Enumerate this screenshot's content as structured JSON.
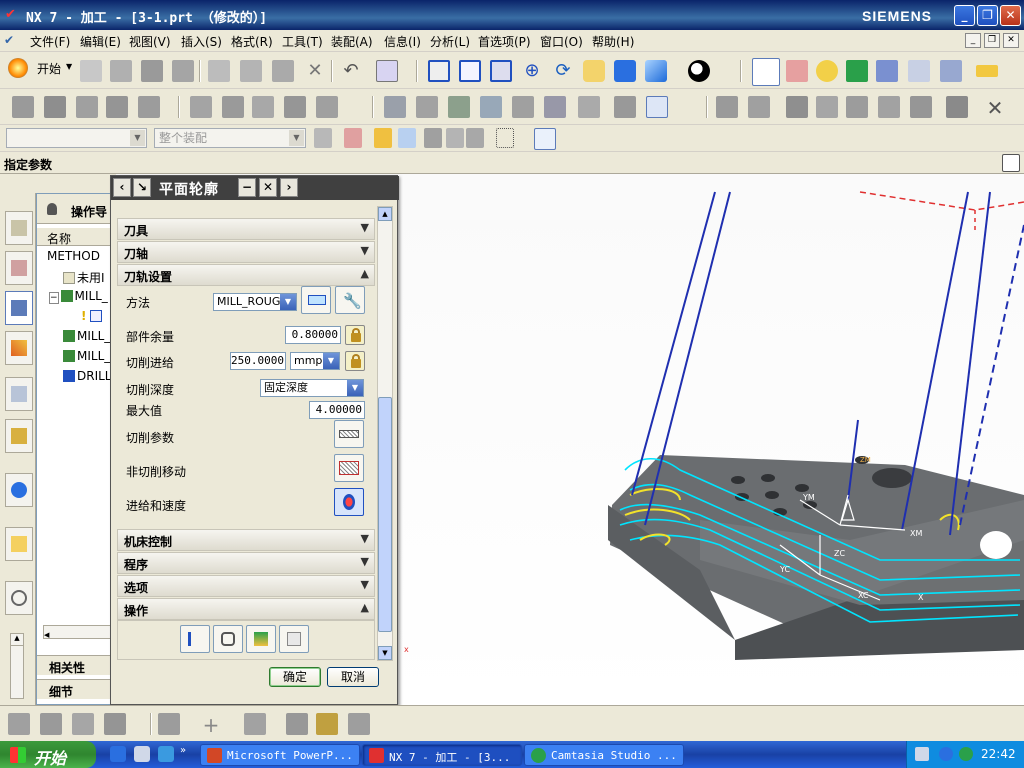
{
  "window": {
    "title": "NX 7 - 加工 - [3-1.prt （修改的）]",
    "brand": "SIEMENS",
    "minimize": "_",
    "restore": "❐",
    "close": "✕"
  },
  "menu": {
    "items": [
      "文件(F)",
      "编辑(E)",
      "视图(V)",
      "插入(S)",
      "格式(R)",
      "工具(T)",
      "装配(A)",
      "信息(I)",
      "分析(L)",
      "首选项(P)",
      "窗口(O)",
      "帮助(H)"
    ]
  },
  "toolbar": {
    "start_label": "开始",
    "filter_combo": "",
    "assembly_combo": "整个装配"
  },
  "cue_line": "指定参数",
  "navigator": {
    "title": "操作导",
    "column_name": "名称",
    "rows": [
      "METHOD",
      "未用I",
      "MILL_",
      "",
      "MILL_",
      "MILL_",
      "DRILL"
    ],
    "relations": "相关性",
    "details": "细节"
  },
  "dialog": {
    "title": "平面轮廓",
    "sections": {
      "tool": "刀具",
      "axis": "刀轴",
      "path_settings": "刀轨设置",
      "machine_control": "机床控制",
      "program": "程序",
      "options": "选项",
      "actions": "操作"
    },
    "fields": {
      "method_label": "方法",
      "method_value": "MILL_ROUGH",
      "stock_label": "部件余量",
      "stock_value": "0.80000",
      "feed_label": "切削进给",
      "feed_value": "250.0000",
      "feed_unit": "mmpm",
      "depth_label": "切削深度",
      "depth_value": "固定深度",
      "max_label": "最大值",
      "max_value": "4.00000",
      "cut_params_label": "切削参数",
      "noncut_label": "非切削移动",
      "feeds_label": "进给和速度"
    },
    "ok": "确定",
    "cancel": "取消"
  },
  "model_labels": {
    "ym": "YM",
    "xm": "XM",
    "zc": "ZC",
    "yc": "YC",
    "xc": "XC",
    "x": "X",
    "zm": "ZM",
    "x_small": "x"
  },
  "taskbar": {
    "start": "开始",
    "items": [
      "Microsoft PowerP...",
      "NX 7 - 加工 - [3...",
      "Camtasia Studio ..."
    ],
    "clock": "22:42"
  },
  "colors": {
    "tool_path": "#00e5ff",
    "tool_lines": "#1f2fb0",
    "part_top": "#6a6d70",
    "part_side": "#4d5053",
    "part_front": "#7a7d80",
    "wcs_dash": "#e03030"
  }
}
